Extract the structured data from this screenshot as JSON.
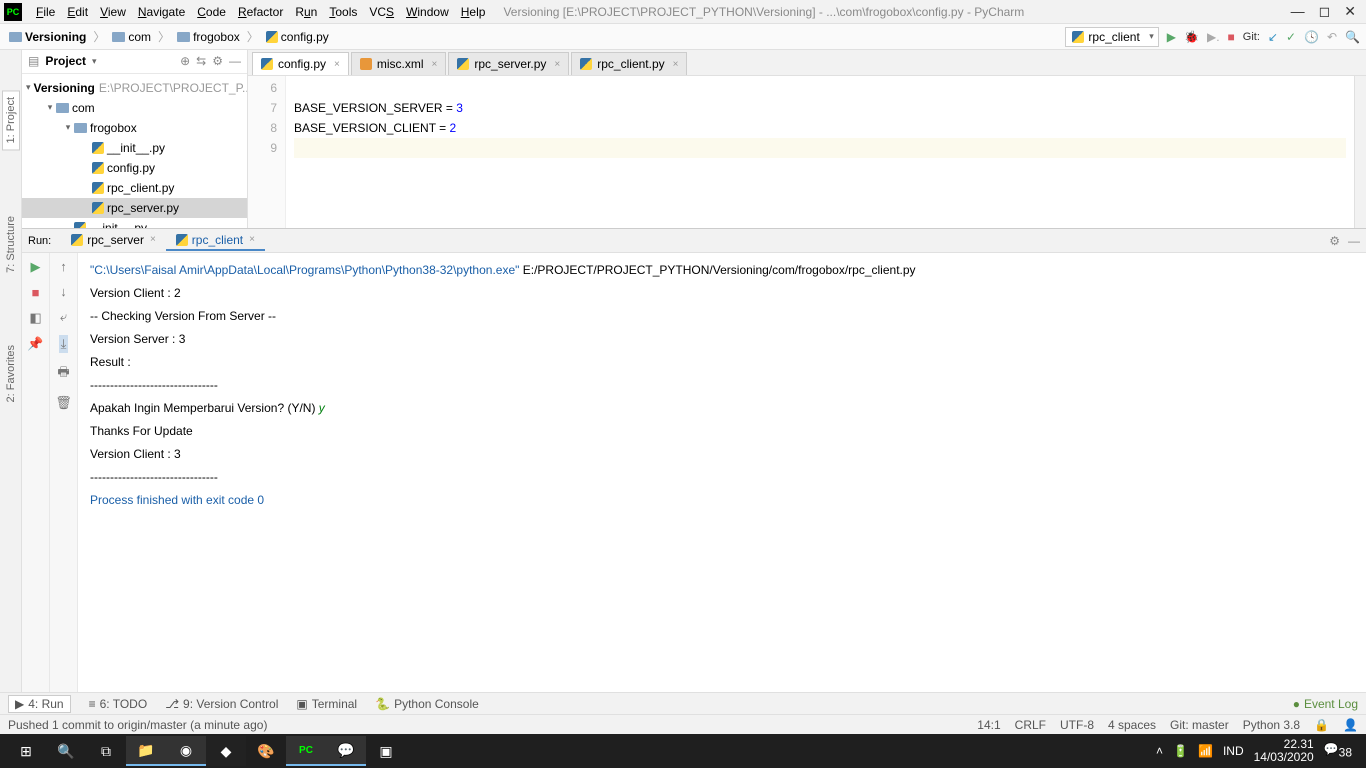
{
  "menu": {
    "items": [
      "File",
      "Edit",
      "View",
      "Navigate",
      "Code",
      "Refactor",
      "Run",
      "Tools",
      "VCS",
      "Window",
      "Help"
    ],
    "title": "Versioning [E:\\PROJECT\\PROJECT_PYTHON\\Versioning] - ...\\com\\frogobox\\config.py - PyCharm"
  },
  "breadcrumb": {
    "items": [
      "Versioning",
      "com",
      "frogobox",
      "config.py"
    ]
  },
  "runconfig": "rpc_client",
  "git_label": "Git:",
  "project_panel": {
    "title": "Project",
    "root": {
      "name": "Versioning",
      "path": "E:\\PROJECT\\PROJECT_P..."
    },
    "com": "com",
    "frogobox": "frogobox",
    "files": [
      "__init__.py",
      "config.py",
      "rpc_client.py",
      "rpc_server.py"
    ],
    "init2": "__init__.py"
  },
  "editor_tabs": [
    {
      "name": "config.py",
      "type": "py",
      "active": true
    },
    {
      "name": "misc.xml",
      "type": "xml",
      "active": false
    },
    {
      "name": "rpc_server.py",
      "type": "py",
      "active": false
    },
    {
      "name": "rpc_client.py",
      "type": "py",
      "active": false
    }
  ],
  "code": {
    "lines": [
      "6",
      "7",
      "8",
      "9"
    ],
    "l7_a": "BASE_VERSION_SERVER ",
    "l7_b": "= ",
    "l7_c": "3",
    "l8_a": "BASE_VERSION_CLIENT ",
    "l8_b": "= ",
    "l8_c": "2"
  },
  "run_panel": {
    "label": "Run:",
    "tabs": [
      {
        "name": "rpc_server",
        "active": false
      },
      {
        "name": "rpc_client",
        "active": true
      }
    ]
  },
  "console": {
    "l1a": "\"C:\\Users\\Faisal Amir\\AppData\\Local\\Programs\\Python\\Python38-32\\python.exe\"",
    "l1b": " E:/PROJECT/PROJECT_PYTHON/Versioning/com/frogobox/rpc_client.py",
    "l2": "Version Client  : 2",
    "l3": "-- Checking Version From Server --",
    "l4": "Version Server  : 3",
    "l5": "",
    "l6": "Result :",
    "l7": "--------------------------------",
    "l8a": "Apakah Ingin Memperbarui Version? (Y/N) ",
    "l8b": "y",
    "l9": "Thanks For Update",
    "l10": "Version Client   : 3",
    "l11": "--------------------------------",
    "l12": "",
    "l13": "Process finished with exit code 0"
  },
  "bottom_tabs": {
    "run": "4: Run",
    "todo": "6: TODO",
    "vcs": "9: Version Control",
    "terminal": "Terminal",
    "pyconsole": "Python Console",
    "eventlog": "Event Log"
  },
  "status": {
    "left": "Pushed 1 commit to origin/master (a minute ago)",
    "pos": "14:1",
    "eol": "CRLF",
    "enc": "UTF-8",
    "indent": "4 spaces",
    "git": "Git: master",
    "py": "Python 3.8"
  },
  "taskbar": {
    "lang": "IND",
    "time": "22.31",
    "date": "14/03/2020",
    "notif": "38"
  },
  "left_tabs": {
    "project": "1: Project",
    "structure": "7: Structure",
    "favorites": "2: Favorites"
  }
}
